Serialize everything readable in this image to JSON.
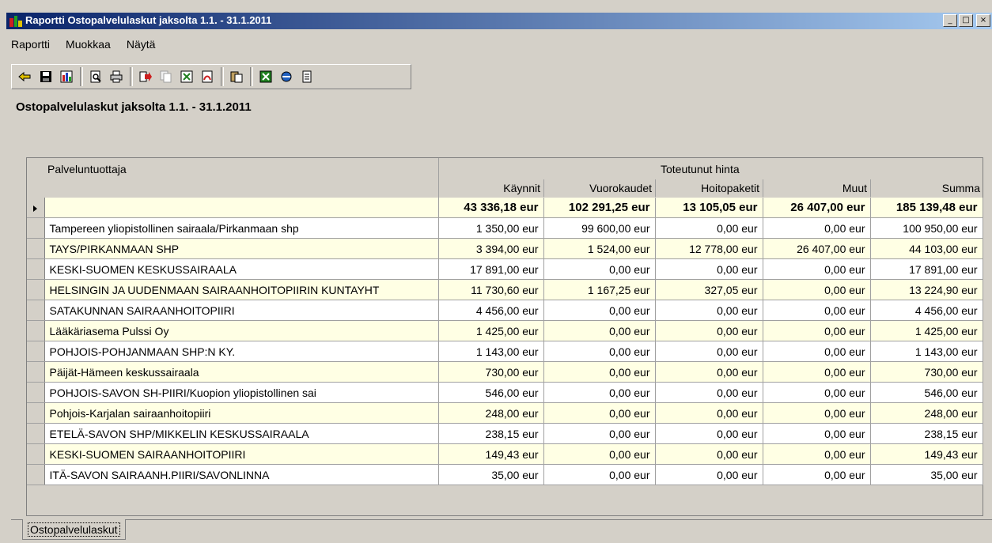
{
  "window": {
    "title": "Raportti Ostopalvelulaskut jaksolta 1.1. - 31.1.2011",
    "buttons": {
      "minimize": "_",
      "maximize": "□",
      "close": "×"
    }
  },
  "menu": {
    "items": [
      "Raportti",
      "Muokkaa",
      "Näytä"
    ]
  },
  "toolbar": {
    "icons": [
      "exit-icon",
      "save-icon",
      "report-icon",
      "preview-icon",
      "print-icon",
      "export-icon",
      "copy-doc-icon",
      "excel-export-icon",
      "pdf-icon",
      "paste-icon",
      "excel-icon",
      "browser-icon",
      "notes-icon"
    ]
  },
  "report": {
    "heading": "Ostopalvelulaskut jaksolta 1.1. - 31.1.2011"
  },
  "grid": {
    "provider_header": "Palveluntuottaja",
    "group_header": "Toteutunut hinta",
    "columns": [
      "Käynnit",
      "Vuorokaudet",
      "Hoitopaketit",
      "Muut",
      "Summa"
    ],
    "totals": [
      "43 336,18 eur",
      "102 291,25 eur",
      "13 105,05 eur",
      "26 407,00 eur",
      "185 139,48 eur"
    ],
    "rows": [
      {
        "name": "Tampereen yliopistollinen sairaala/Pirkanmaan shp",
        "values": [
          "1 350,00 eur",
          "99 600,00 eur",
          "0,00 eur",
          "0,00 eur",
          "100 950,00 eur"
        ]
      },
      {
        "name": "TAYS/PIRKANMAAN SHP",
        "values": [
          "3 394,00 eur",
          "1 524,00 eur",
          "12 778,00 eur",
          "26 407,00 eur",
          "44 103,00 eur"
        ]
      },
      {
        "name": "KESKI-SUOMEN KESKUSSAIRAALA",
        "values": [
          "17 891,00 eur",
          "0,00 eur",
          "0,00 eur",
          "0,00 eur",
          "17 891,00 eur"
        ]
      },
      {
        "name": "HELSINGIN JA UUDENMAAN SAIRAANHOITOPIIRIN KUNTAYHT",
        "values": [
          "11 730,60 eur",
          "1 167,25 eur",
          "327,05 eur",
          "0,00 eur",
          "13 224,90 eur"
        ]
      },
      {
        "name": "SATAKUNNAN SAIRAANHOITOPIIRI",
        "values": [
          "4 456,00 eur",
          "0,00 eur",
          "0,00 eur",
          "0,00 eur",
          "4 456,00 eur"
        ]
      },
      {
        "name": "Lääkäriasema Pulssi Oy",
        "values": [
          "1 425,00 eur",
          "0,00 eur",
          "0,00 eur",
          "0,00 eur",
          "1 425,00 eur"
        ]
      },
      {
        "name": "POHJOIS-POHJANMAAN SHP:N KY.",
        "values": [
          "1 143,00 eur",
          "0,00 eur",
          "0,00 eur",
          "0,00 eur",
          "1 143,00 eur"
        ]
      },
      {
        "name": "Päijät-Hämeen keskussairaala",
        "values": [
          "730,00 eur",
          "0,00 eur",
          "0,00 eur",
          "0,00 eur",
          "730,00 eur"
        ]
      },
      {
        "name": "POHJOIS-SAVON SH-PIIRI/Kuopion yliopistollinen sai",
        "values": [
          "546,00 eur",
          "0,00 eur",
          "0,00 eur",
          "0,00 eur",
          "546,00 eur"
        ]
      },
      {
        "name": "Pohjois-Karjalan sairaanhoitopiiri",
        "values": [
          "248,00 eur",
          "0,00 eur",
          "0,00 eur",
          "0,00 eur",
          "248,00 eur"
        ]
      },
      {
        "name": "ETELÄ-SAVON SHP/MIKKELIN KESKUSSAIRAALA",
        "values": [
          "238,15 eur",
          "0,00 eur",
          "0,00 eur",
          "0,00 eur",
          "238,15 eur"
        ]
      },
      {
        "name": "KESKI-SUOMEN SAIRAANHOITOPIIRI",
        "values": [
          "149,43 eur",
          "0,00 eur",
          "0,00 eur",
          "0,00 eur",
          "149,43 eur"
        ]
      },
      {
        "name": "ITÄ-SAVON SAIRAANH.PIIRI/SAVONLINNA",
        "values": [
          "35,00 eur",
          "0,00 eur",
          "0,00 eur",
          "0,00 eur",
          "35,00 eur"
        ]
      }
    ]
  },
  "tabs": {
    "active": "Ostopalvelulaskut"
  }
}
